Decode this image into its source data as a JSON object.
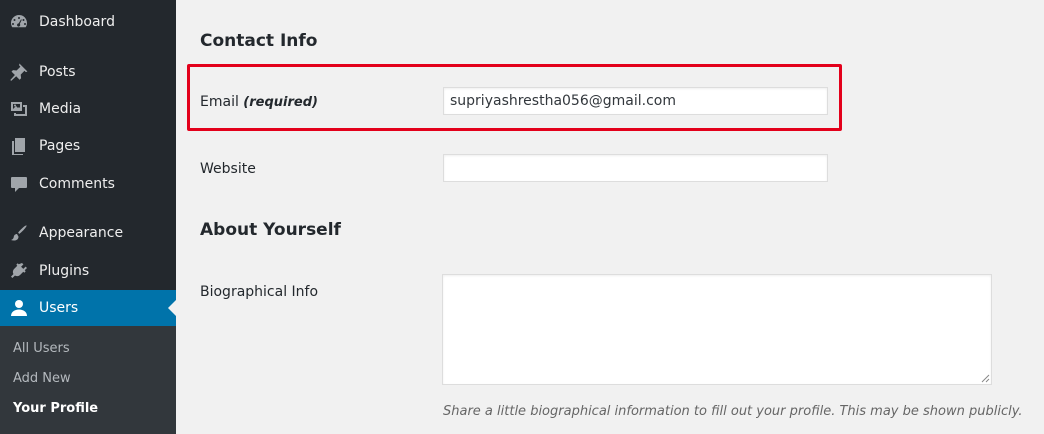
{
  "sidebar": {
    "items": [
      {
        "label": "Dashboard",
        "icon": "dashboard-icon"
      },
      {
        "label": "Posts",
        "icon": "pin-icon"
      },
      {
        "label": "Media",
        "icon": "media-icon"
      },
      {
        "label": "Pages",
        "icon": "pages-icon"
      },
      {
        "label": "Comments",
        "icon": "comment-icon"
      },
      {
        "label": "Appearance",
        "icon": "paintbrush-icon"
      },
      {
        "label": "Plugins",
        "icon": "plug-icon"
      },
      {
        "label": "Users",
        "icon": "user-icon",
        "active": true
      }
    ],
    "submenu": [
      {
        "label": "All Users"
      },
      {
        "label": "Add New"
      },
      {
        "label": "Your Profile",
        "current": true
      }
    ]
  },
  "main": {
    "contact_title": "Contact Info",
    "email_label": "Email",
    "email_required": "(required)",
    "email_value": "supriyashrestha056@gmail.com",
    "website_label": "Website",
    "website_value": "",
    "about_title": "About Yourself",
    "bio_label": "Biographical Info",
    "bio_value": "",
    "bio_description": "Share a little biographical information to fill out your profile. This may be shown publicly."
  },
  "colors": {
    "sidebar_bg": "#23282d",
    "submenu_bg": "#32373c",
    "active_bg": "#0073aa",
    "highlight": "#e3001b",
    "content_bg": "#f1f1f1"
  }
}
